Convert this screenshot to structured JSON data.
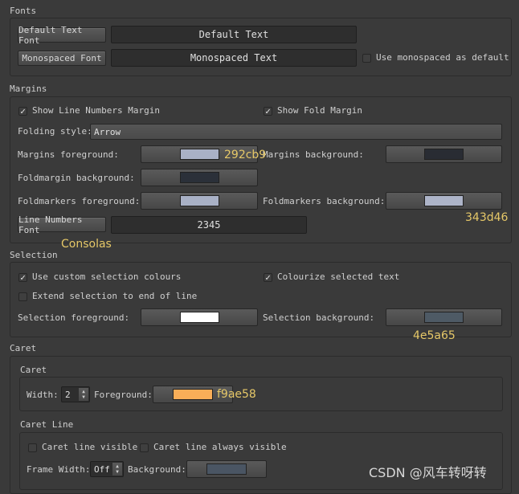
{
  "fonts": {
    "title": "Fonts",
    "default_font_button": "Default Text Font",
    "default_text_preview": "Default Text",
    "mono_font_button": "Monospaced Font",
    "mono_text_preview": "Monospaced Text",
    "use_mono_default": {
      "label": "Use monospaced as default",
      "checked": false
    }
  },
  "margins": {
    "title": "Margins",
    "show_line_numbers": {
      "label": "Show Line Numbers Margin",
      "checked": true
    },
    "show_fold": {
      "label": "Show Fold Margin",
      "checked": true
    },
    "folding_style_label": "Folding style:",
    "folding_style_value": "Arrow",
    "margins_fg_label": "Margins foreground:",
    "margins_fg_color": "#a9b1c6",
    "margins_bg_label": "Margins background:",
    "margins_bg_color": "#292c33",
    "foldmargin_bg_label": "Foldmargin background:",
    "foldmargin_bg_color": "#2b3039",
    "foldmarkers_fg_label": "Foldmarkers foreground:",
    "foldmarkers_fg_color": "#a9b1c6",
    "foldmarkers_bg_label": "Foldmarkers background:",
    "foldmarkers_bg_color": "#adb4c8",
    "line_numbers_font_button": "Line Numbers Font",
    "line_numbers_preview": "2345"
  },
  "selection": {
    "title": "Selection",
    "use_custom": {
      "label": "Use custom selection colours",
      "checked": true
    },
    "colourize": {
      "label": "Colourize selected text",
      "checked": true
    },
    "extend_eol": {
      "label": "Extend selection to end of line",
      "checked": false
    },
    "fg_label": "Selection foreground:",
    "fg_color": "#ffffff",
    "bg_label": "Selection background:",
    "bg_color": "#4e5a65"
  },
  "caret": {
    "title": "Caret",
    "inner_title": "Caret",
    "width_label": "Width:",
    "width_value": "2",
    "foreground_label": "Foreground:",
    "foreground_color": "#f9ae58",
    "caret_line_title": "Caret Line",
    "line_visible": {
      "label": "Caret line visible",
      "checked": false
    },
    "line_always_visible": {
      "label": "Caret line always visible",
      "checked": false
    },
    "frame_width_label": "Frame Width:",
    "frame_width_value": "Off",
    "background_label": "Background:",
    "background_color": "#4a5563"
  },
  "annotations": {
    "margins_fg_hex": "292cb9",
    "foldmarkers_bg_hex": "343d46",
    "line_font_name": "Consolas",
    "selection_bg_hex": "4e5a65",
    "caret_fg_hex": "f9ae58"
  },
  "watermark": "CSDN @风车转呀转",
  "check_glyph": "✓"
}
